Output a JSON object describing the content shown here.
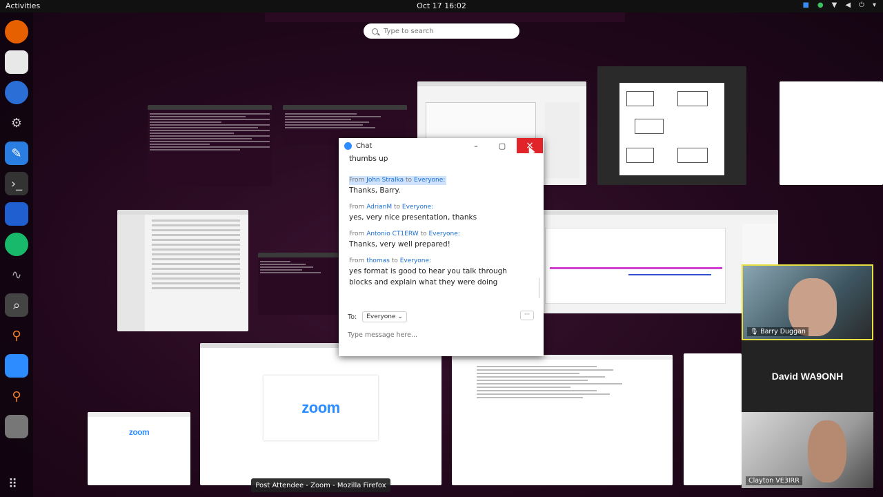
{
  "topbar": {
    "activities": "Activities",
    "clock": "Oct 17  16:02"
  },
  "search": {
    "placeholder": "Type to search"
  },
  "chat": {
    "title": "Chat",
    "first_line": "thumbs up",
    "messages": [
      {
        "from_label": "From",
        "sender": "John Stralka",
        "to_label": "to",
        "recipient": "Everyone:",
        "text": "Thanks, Barry."
      },
      {
        "from_label": "From",
        "sender": "AdrianM",
        "to_label": "to",
        "recipient": "Everyone:",
        "text": "yes, very nice presentation, thanks"
      },
      {
        "from_label": "From",
        "sender": "Antonio CT1ERW",
        "to_label": "to",
        "recipient": "Everyone:",
        "text": "Thanks, very well prepared!"
      },
      {
        "from_label": "From",
        "sender": "thomas",
        "to_label": "to",
        "recipient": "Everyone:",
        "text": "yes format is good to hear you talk through blocks and explain what they were doing"
      }
    ],
    "to_label": "To:",
    "to_value": "Everyone",
    "more_label": "···",
    "input_placeholder": "Type message here..."
  },
  "video": {
    "tile1_name": "Barry Duggan",
    "tile2_name": "David WA9ONH",
    "tile3_name": "Clayton VE3IRR"
  },
  "thumbs": {
    "zoom_brand": "zoom",
    "zoom_brand_small": "zoom"
  },
  "tooltip": "Post Attendee - Zoom - Mozilla Firefox",
  "colors": {
    "accent": "#2d8cff",
    "close": "#e0242a",
    "highlight": "#e8e043"
  }
}
